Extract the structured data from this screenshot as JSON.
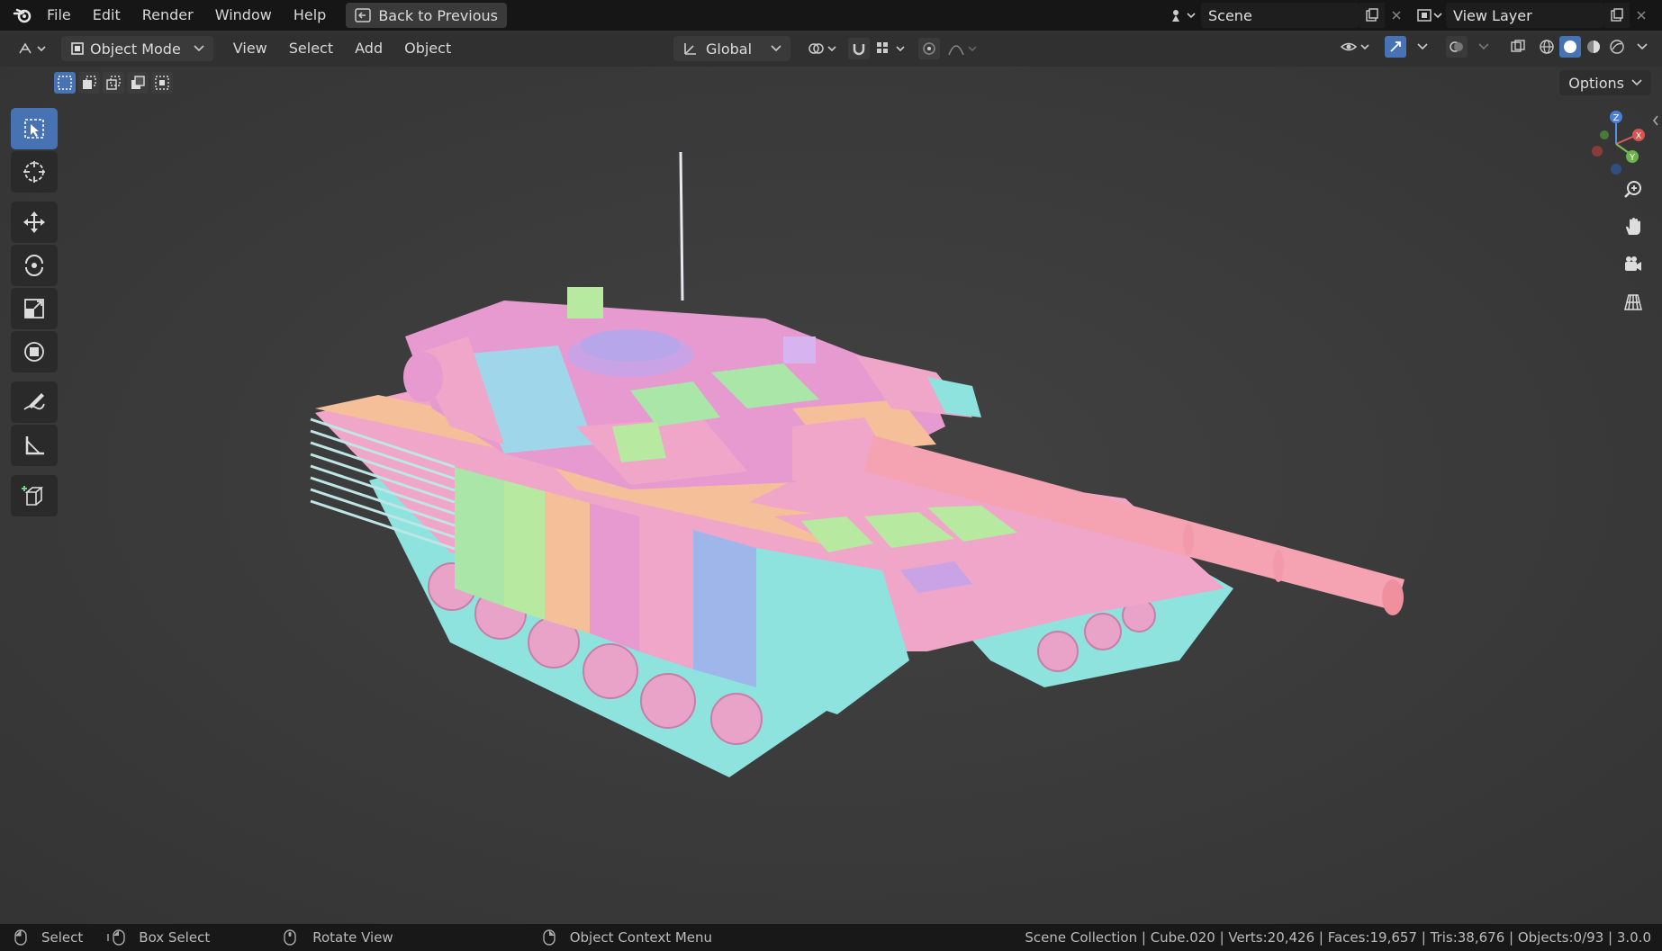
{
  "topbar": {
    "menus": [
      "File",
      "Edit",
      "Render",
      "Window",
      "Help"
    ],
    "back_button": "Back to Previous",
    "scene_label": "Scene",
    "view_layer_label": "View Layer"
  },
  "header": {
    "mode": "Object Mode",
    "menus": [
      "View",
      "Select",
      "Add",
      "Object"
    ],
    "orientation": "Global",
    "options_label": "Options"
  },
  "toolbar": {
    "tools": [
      "select-box",
      "cursor",
      "move",
      "rotate",
      "scale",
      "transform",
      "annotate",
      "measure",
      "add-cube"
    ],
    "active_tool": "select-box"
  },
  "statusbar": {
    "select": "Select",
    "box_select": "Box Select",
    "rotate_view": "Rotate View",
    "context_menu": "Object Context Menu",
    "stats": "Scene Collection | Cube.020 | Verts:20,426 | Faces:19,657 | Tris:38,676 | Objects:0/93 | 3.0.0"
  },
  "colors": {
    "accent": "#4772b3",
    "viewport_bg": "#3b3b3b",
    "topbar_bg": "#161616"
  }
}
